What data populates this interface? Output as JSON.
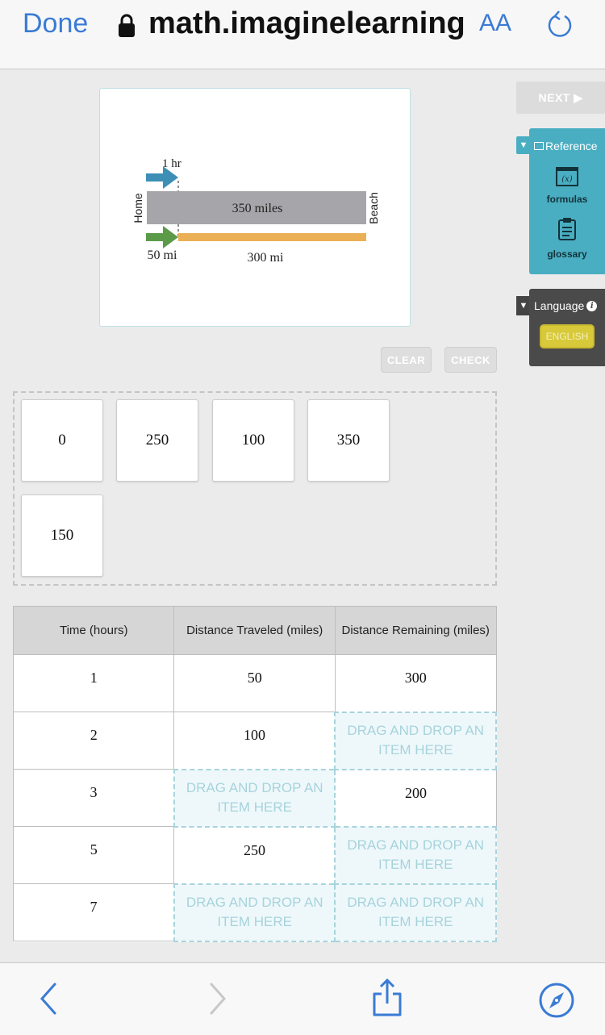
{
  "browser": {
    "done_label": "Done",
    "url": "math.imaginelearning",
    "text_size_label": "AA",
    "icons": [
      "lock-icon",
      "text-size-icon",
      "reload-icon"
    ]
  },
  "figure": {
    "time_label": "1 hr",
    "start_label": "Home",
    "end_label": "Beach",
    "total_label": "350 miles",
    "traveled_label": "50 mi",
    "remaining_label": "300 mi",
    "colors": {
      "time_arrow": "#3d8fb5",
      "traveled_arrow": "#5b9a49",
      "total_bar": "#a6a6aa",
      "remaining_bar": "#ebb055"
    }
  },
  "sidebar": {
    "next_label": "NEXT ▶",
    "reference": {
      "title": "Reference",
      "items": [
        {
          "label": "formulas",
          "icon": "formula-icon"
        },
        {
          "label": "glossary",
          "icon": "clipboard-icon"
        }
      ]
    },
    "language": {
      "title": "Language",
      "selected": "ENGLISH"
    }
  },
  "actions": {
    "clear_label": "CLEAR",
    "check_label": "CHECK"
  },
  "answer_bank": {
    "tiles": [
      "0",
      "250",
      "100",
      "350",
      "150"
    ]
  },
  "table": {
    "headers": [
      "Time (hours)",
      "Distance Traveled (miles)",
      "Distance Remaining (miles)"
    ],
    "drop_placeholder": "DRAG AND DROP AN ITEM HERE",
    "rows": [
      {
        "time": "1",
        "traveled": "50",
        "remaining": "300"
      },
      {
        "time": "2",
        "traveled": "100",
        "remaining": null
      },
      {
        "time": "3",
        "traveled": null,
        "remaining": "200"
      },
      {
        "time": "5",
        "traveled": "250",
        "remaining": null
      },
      {
        "time": "7",
        "traveled": null,
        "remaining": null
      }
    ]
  },
  "toolbar": {
    "icons": [
      "back-icon",
      "forward-icon",
      "share-icon",
      "compass-icon"
    ]
  }
}
